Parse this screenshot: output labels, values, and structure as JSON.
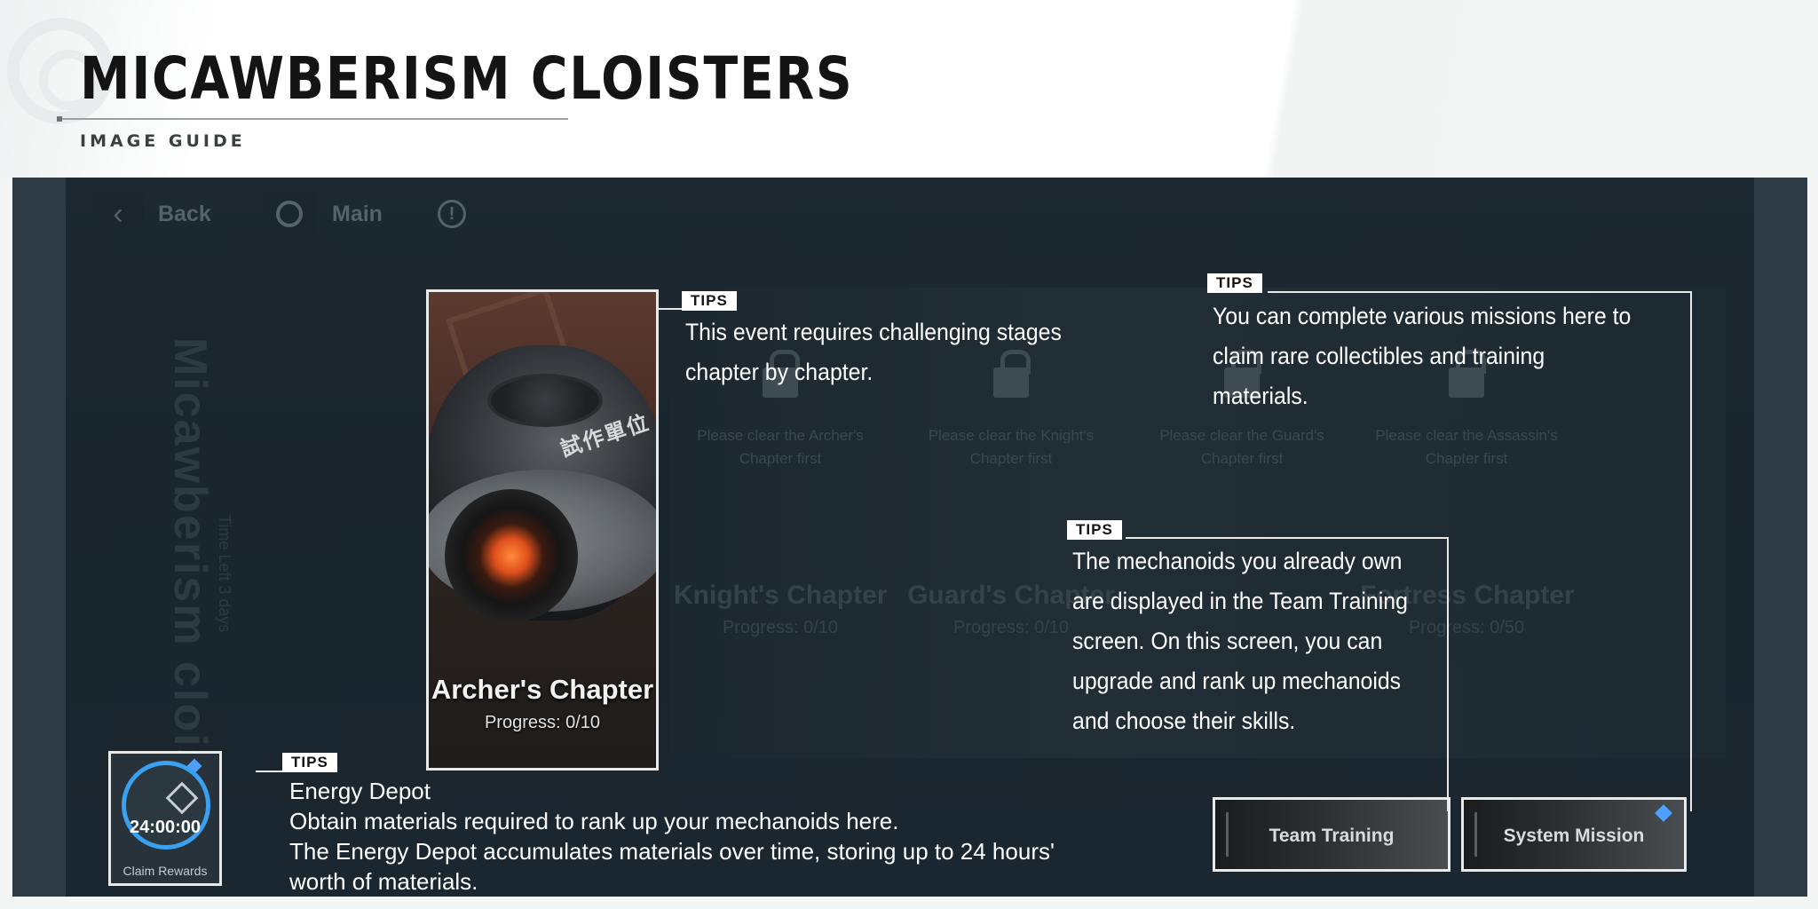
{
  "header": {
    "title": "MICAWBERISM CLOISTERS",
    "subtitle": "IMAGE GUIDE"
  },
  "nav": {
    "back_label": "Back",
    "main_label": "Main",
    "info_glyph": "!"
  },
  "event": {
    "vertical_title": "Micawberism cloisters",
    "time_left": "Time Left 3 days"
  },
  "chapters": [
    {
      "name": "Archer's Chapter",
      "progress": "Progress: 0/10",
      "lock_msg": ""
    },
    {
      "name": "Knight's Chapter",
      "progress": "Progress: 0/10",
      "lock_msg": "Please clear the Archer's Chapter first"
    },
    {
      "name": "Guard's Chapter",
      "progress": "Progress: 0/10",
      "lock_msg": "Please clear the Knight's Chapter first"
    },
    {
      "name": "Guard's Chapter",
      "progress": "Progress: 0/10",
      "lock_msg": "Please clear the Guard's Chapter first"
    },
    {
      "name": "Fortress Chapter",
      "progress": "Progress: 0/50",
      "lock_msg": "Please clear the Assassin's Chapter first"
    }
  ],
  "archer_card": {
    "stamp": "試作單位"
  },
  "depot": {
    "timer": "24:00:00",
    "claim_label": "Claim Rewards"
  },
  "buttons": {
    "team_training": "Team Training",
    "system_mission": "System Mission"
  },
  "tips": {
    "tag": "TIPS",
    "chapter": [
      "This event requires challenging stages",
      "chapter by chapter."
    ],
    "missions": [
      "You can complete various missions here to",
      "claim rare collectibles and training",
      "materials."
    ],
    "mechanoids": [
      "The mechanoids you already own",
      "are displayed in the Team Training",
      "screen. On this screen, you can",
      "upgrade and rank up mechanoids",
      "and choose their skills."
    ],
    "depot": [
      "Energy Depot",
      "Obtain materials required to rank up your mechanoids here.",
      "The Energy Depot accumulates materials over time, storing up to 24 hours'",
      "worth of materials."
    ]
  },
  "colors": {
    "accent_blue": "#3aa0f0",
    "badge_blue": "#4ea0ff",
    "highlight_border": "#e8eaea"
  }
}
